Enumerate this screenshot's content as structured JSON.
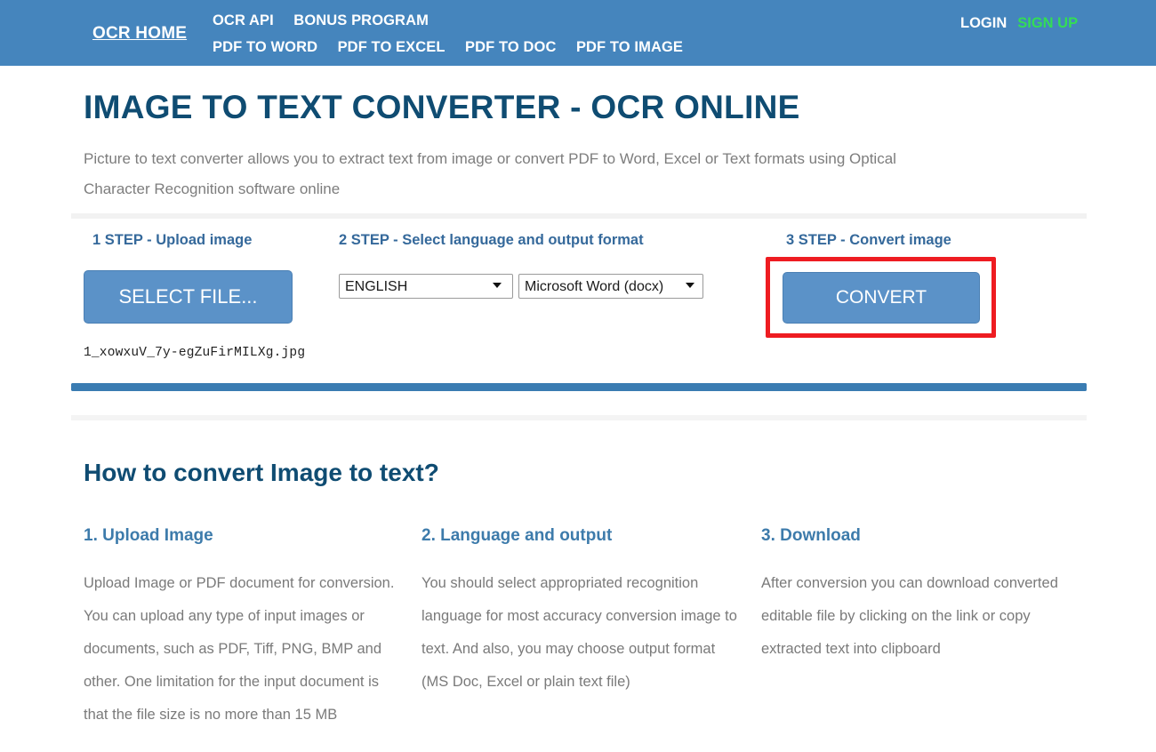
{
  "navbar": {
    "brand": "OCR HOME",
    "links_row1": [
      {
        "label": "OCR API"
      },
      {
        "label": "BONUS PROGRAM"
      }
    ],
    "links_row2": [
      {
        "label": "PDF TO WORD"
      },
      {
        "label": "PDF TO EXCEL"
      },
      {
        "label": "PDF TO DOC"
      },
      {
        "label": "PDF TO IMAGE"
      }
    ],
    "login_label": "LOGIN",
    "signup_label": "SIGN UP",
    "bg_color": "#4585bd",
    "signup_color": "#33dd55"
  },
  "hero": {
    "title": "IMAGE TO TEXT CONVERTER - OCR ONLINE",
    "subtitle": "Picture to text converter allows you to extract text from image or convert PDF to Word, Excel or Text formats using Optical Character Recognition software online",
    "title_color": "#0f4c72"
  },
  "steps": {
    "step1": {
      "label": "1 STEP - Upload image",
      "button_label": "SELECT FILE...",
      "file_name": "1_xowxuV_7y-egZuFirMILXg.jpg"
    },
    "step2": {
      "label": "2 STEP - Select language and output format",
      "language_selected": "ENGLISH",
      "format_selected": "Microsoft Word (docx)"
    },
    "step3": {
      "label": "3 STEP - Convert image",
      "button_label": "CONVERT",
      "highlight_color": "#ee1c21"
    }
  },
  "progress": {
    "percent": 100,
    "color": "#3a7cb2"
  },
  "howto": {
    "section_title": "How to convert Image to text?",
    "columns": [
      {
        "heading": "1. Upload Image",
        "body": "Upload Image or PDF document for conversion. You can upload any type of input images or documents, such as PDF, Tiff, PNG, BMP and other. One limitation for the input document is that the file size is no more than 15 MB"
      },
      {
        "heading": "2. Language and output",
        "body": "You should select appropriated recognition language for most accuracy conversion image to text. And also, you may choose output format (MS Doc, Excel or plain text file)"
      },
      {
        "heading": "3. Download",
        "body": "After conversion you can download converted editable file by clicking on the link or copy extracted text into clipboard"
      }
    ]
  }
}
